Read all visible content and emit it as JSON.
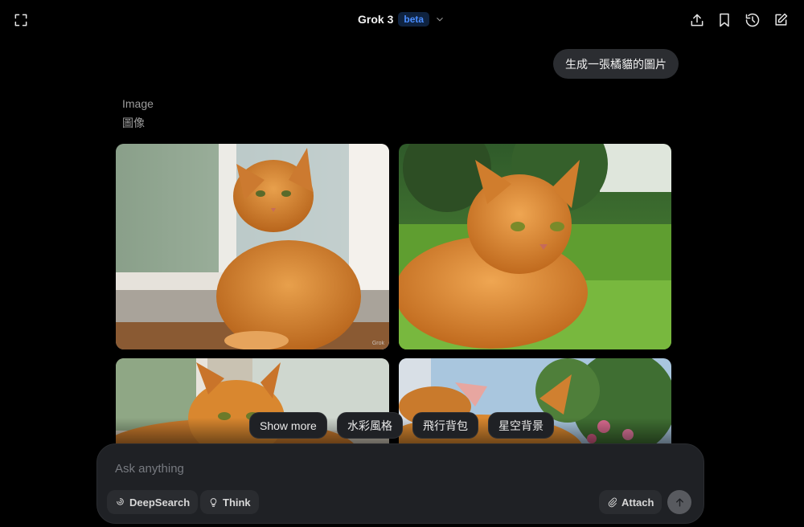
{
  "header": {
    "model_name": "Grok 3",
    "badge": "beta",
    "left_icon": "expand-icon",
    "right_icons": [
      "share-icon",
      "bookmark-icon",
      "history-icon",
      "new-chat-icon"
    ]
  },
  "conversation": {
    "user_message": "生成一張橘貓的圖片",
    "response_label_en": "Image",
    "response_label_zh": "圖像",
    "images": [
      {
        "alt": "Orange tabby cat sitting by a window",
        "watermark": "Grok"
      },
      {
        "alt": "Orange tabby cat lying on green grass"
      },
      {
        "alt": "Orange tabby cat close-up near window"
      },
      {
        "alt": "Orange tabby cat in garden with flowers"
      }
    ]
  },
  "suggestions": [
    "Show more",
    "水彩風格",
    "飛行背包",
    "星空背景"
  ],
  "composer": {
    "placeholder": "Ask anything",
    "deepsearch_label": "DeepSearch",
    "think_label": "Think",
    "attach_label": "Attach"
  },
  "colors": {
    "background": "#000000",
    "surface": "#1f2125",
    "bubble": "#2b2d31",
    "badge_text": "#4a8dff",
    "cat_orange": "#d9822b"
  }
}
